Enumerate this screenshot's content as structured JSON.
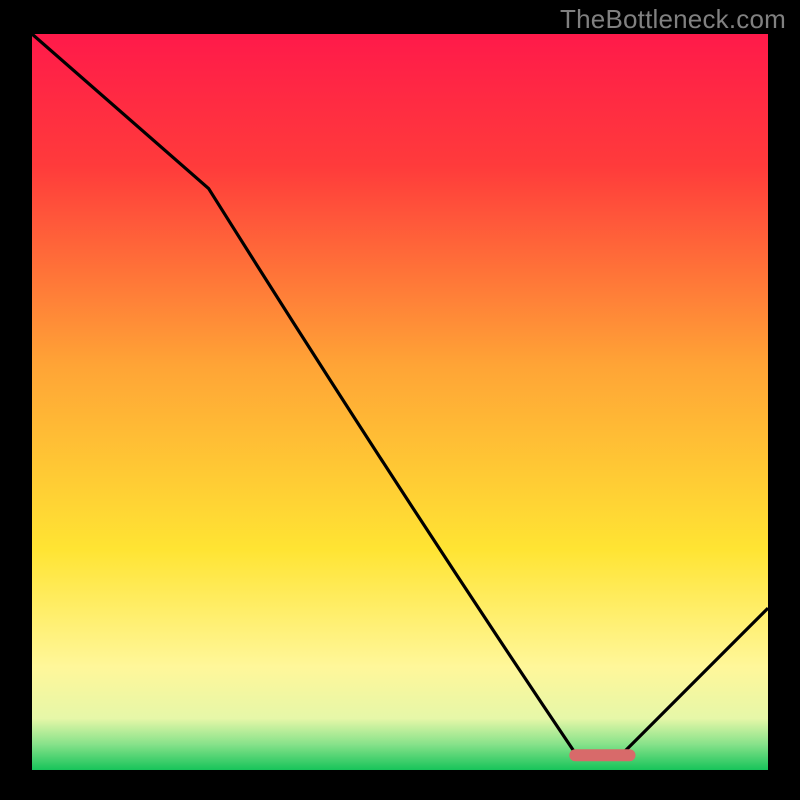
{
  "watermark": "TheBottleneck.com",
  "chart_data": {
    "type": "line",
    "title": "",
    "xlabel": "",
    "ylabel": "",
    "xlim": [
      0,
      100
    ],
    "ylim": [
      0,
      100
    ],
    "grid": false,
    "curve": {
      "name": "bottleneck-curve",
      "x": [
        0,
        24,
        74,
        80,
        100
      ],
      "y": [
        100,
        79,
        2,
        2,
        22
      ]
    },
    "marker": {
      "x_start": 73,
      "x_end": 82,
      "y": 2,
      "color": "#d86a6a"
    },
    "background_gradient": {
      "stops": [
        {
          "pos": 0.0,
          "color": "#ff1a4a"
        },
        {
          "pos": 0.18,
          "color": "#ff3b3b"
        },
        {
          "pos": 0.45,
          "color": "#ffa436"
        },
        {
          "pos": 0.7,
          "color": "#ffe433"
        },
        {
          "pos": 0.86,
          "color": "#fff79a"
        },
        {
          "pos": 0.93,
          "color": "#e6f7a8"
        },
        {
          "pos": 0.965,
          "color": "#87e28a"
        },
        {
          "pos": 1.0,
          "color": "#17c45a"
        }
      ]
    }
  }
}
